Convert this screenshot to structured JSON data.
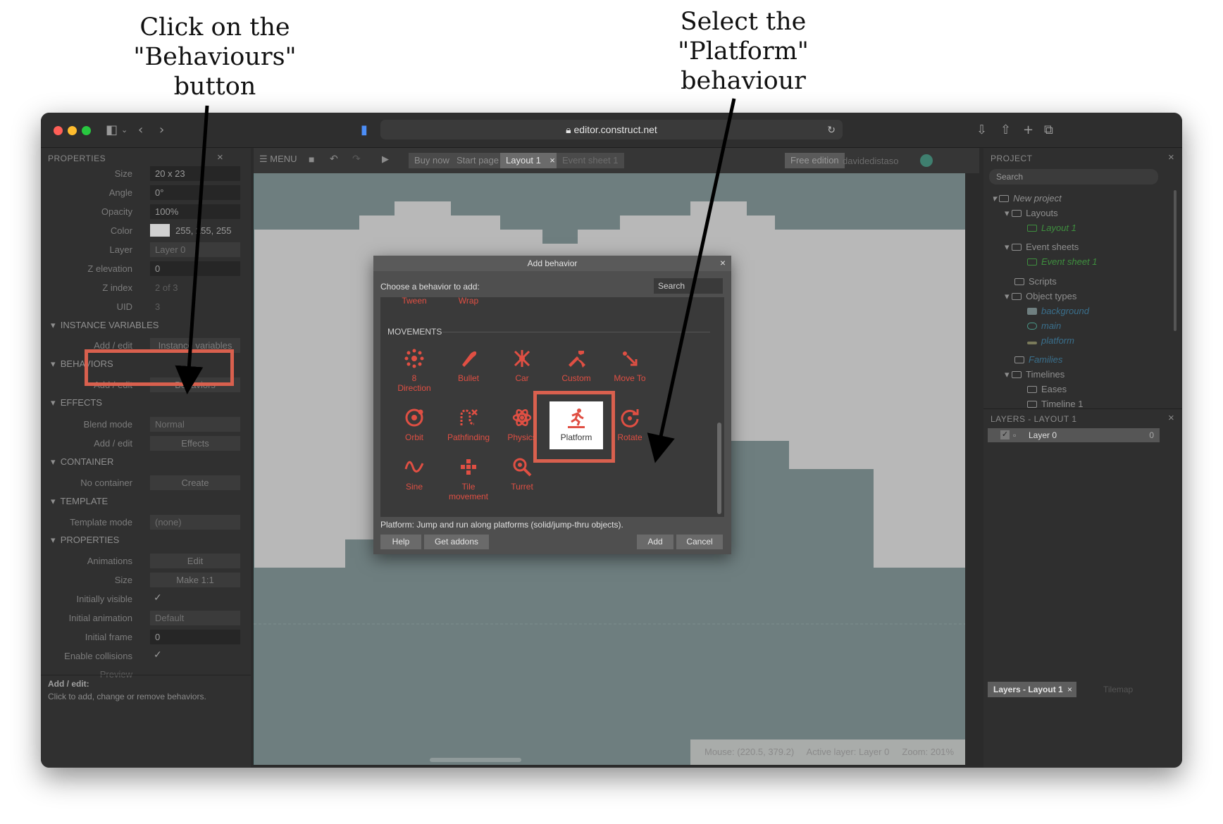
{
  "annotations": {
    "left": [
      "Click on the",
      "\"Behaviours\"",
      "button"
    ],
    "right": [
      "Select the",
      "\"Platform\"",
      "behaviour"
    ]
  },
  "browser": {
    "url": "editor.construct.net",
    "traffic_colors": {
      "close": "#ff5f57",
      "minimize": "#febc2e",
      "zoom": "#28c840"
    }
  },
  "properties_panel": {
    "title": "PROPERTIES",
    "rows": [
      {
        "label": "Size",
        "value": "20 x 23"
      },
      {
        "label": "Angle",
        "value": "0°"
      },
      {
        "label": "Opacity",
        "value": "100%"
      },
      {
        "label": "Color",
        "value": "255, 255, 255"
      },
      {
        "label": "Layer",
        "value": "Layer 0"
      },
      {
        "label": "Z elevation",
        "value": "0"
      },
      {
        "label": "Z index",
        "value": "2 of 3"
      },
      {
        "label": "UID",
        "value": "3"
      }
    ],
    "instance_variables": {
      "header": "INSTANCE VARIABLES",
      "label": "Add / edit",
      "button": "Instance variables"
    },
    "behaviors": {
      "header": "BEHAVIORS",
      "label": "Add / edit",
      "button": "Behaviors"
    },
    "effects": {
      "header": "EFFECTS",
      "blend_label": "Blend mode",
      "blend_value": "Normal",
      "label": "Add / edit",
      "button": "Effects"
    },
    "container": {
      "header": "CONTAINER",
      "label": "No container",
      "button": "Create"
    },
    "template": {
      "header": "TEMPLATE",
      "label": "Template mode",
      "value": "(none)"
    },
    "properties2": {
      "header": "PROPERTIES",
      "animations_label": "Animations",
      "animations_button": "Edit",
      "size_label": "Size",
      "size_button": "Make 1:1",
      "visible_label": "Initially visible",
      "anim_label": "Initial animation",
      "anim_value": "Default",
      "frame_label": "Initial frame",
      "frame_value": "0",
      "collisions_label": "Enable collisions",
      "preview_label": "Preview"
    },
    "help_title": "Add / edit:",
    "help_text": "Click to add, change or remove behaviors."
  },
  "toolbar": {
    "menu": "MENU",
    "tabs": [
      "Buy now",
      "Start page",
      "Layout 1",
      "Event sheet 1"
    ],
    "free_edition": "Free edition",
    "user": "davidedistaso"
  },
  "status": {
    "mouse": "Mouse: (220.5, 379.2)",
    "layer": "Active layer: Layer 0",
    "zoom": "Zoom: 201%"
  },
  "project_panel": {
    "title": "PROJECT",
    "search_placeholder": "Search",
    "tree": [
      {
        "label": "New project"
      },
      {
        "label": "Layouts"
      },
      {
        "label": "Layout 1"
      },
      {
        "label": "Event sheets"
      },
      {
        "label": "Event sheet 1"
      },
      {
        "label": "Scripts"
      },
      {
        "label": "Object types"
      },
      {
        "label": "background"
      },
      {
        "label": "main"
      },
      {
        "label": "platform"
      },
      {
        "label": "Families"
      },
      {
        "label": "Timelines"
      },
      {
        "label": "Eases"
      },
      {
        "label": "Timeline 1"
      }
    ]
  },
  "layers_panel": {
    "title": "LAYERS - LAYOUT 1",
    "layer_name": "Layer 0",
    "layer_count": "0",
    "tabs": [
      "Layers - Layout 1",
      "Tilemap"
    ]
  },
  "dialog": {
    "title": "Add behavior",
    "prompt": "Choose a behavior to add:",
    "search_placeholder": "Search",
    "top_items": [
      "Tween",
      "Wrap"
    ],
    "section": "MOVEMENTS",
    "items": [
      {
        "label": "8\nDirection",
        "icon": "eight-direction-icon"
      },
      {
        "label": "Bullet",
        "icon": "bullet-icon"
      },
      {
        "label": "Car",
        "icon": "car-icon"
      },
      {
        "label": "Custom",
        "icon": "custom-icon"
      },
      {
        "label": "Move To",
        "icon": "move-to-icon"
      },
      {
        "label": "Orbit",
        "icon": "orbit-icon"
      },
      {
        "label": "Pathfinding",
        "icon": "pathfinding-icon"
      },
      {
        "label": "Physics",
        "icon": "physics-icon"
      },
      {
        "label": "Platform",
        "icon": "platform-icon"
      },
      {
        "label": "Rotate",
        "icon": "rotate-icon"
      },
      {
        "label": "Sine",
        "icon": "sine-icon"
      },
      {
        "label": "Tile\nmovement",
        "icon": "tile-movement-icon"
      },
      {
        "label": "Turret",
        "icon": "turret-icon"
      }
    ],
    "description": "Platform: Jump and run along platforms (solid/jump-thru objects).",
    "buttons": {
      "help": "Help",
      "get_addons": "Get addons",
      "add": "Add",
      "cancel": "Cancel"
    }
  },
  "colors": {
    "accent": "#e04f43",
    "highlight": "#d9604e",
    "sky": "#6e7e7f",
    "cloud": "#b8b8b8"
  }
}
